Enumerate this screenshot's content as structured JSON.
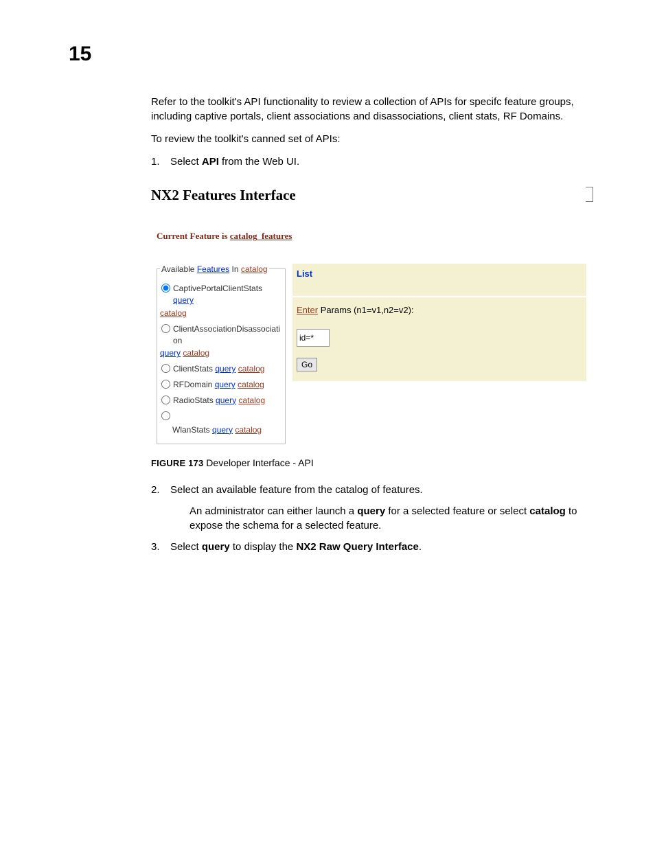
{
  "page": {
    "number": "15"
  },
  "intro": {
    "para1": "Refer to the toolkit's API functionality to review a collection of APIs for specifc feature groups, including captive portals, client associations and disassociations, client stats, RF Domains.",
    "para2": "To review the toolkit's canned set of APIs:"
  },
  "step1": {
    "num": "1.",
    "pre": "Select ",
    "bold": "API",
    "post": " from the Web UI."
  },
  "screenshot": {
    "title": "NX2 Features Interface",
    "current_prefix": "Current Feature is ",
    "current_link": "catalog_features",
    "legend": {
      "pre": "Available ",
      "features": "Features",
      "mid": " In ",
      "catalog": "catalog"
    },
    "features": [
      {
        "name": "CaptivePortalClientStats",
        "q": "query",
        "c": "catalog",
        "checked": true,
        "twoLine": true
      },
      {
        "name": "ClientAssociationDisassociation",
        "q": "query",
        "c": "catalog",
        "checked": false,
        "twoLine": true
      },
      {
        "name": "ClientStats",
        "q": "query",
        "c": "catalog",
        "checked": false,
        "twoLine": false
      },
      {
        "name": "RFDomain",
        "q": "query",
        "c": "catalog",
        "checked": false,
        "twoLine": false
      },
      {
        "name": "RadioStats",
        "q": "query",
        "c": "catalog",
        "checked": false,
        "twoLine": false
      },
      {
        "name": "WlanStats",
        "q": "query",
        "c": "catalog",
        "checked": false,
        "twoLine": false,
        "radioDetached": true
      }
    ],
    "right": {
      "list_label": "List",
      "enter": "Enter",
      "params_rest": " Params (n1=v1,n2=v2):",
      "input_value": "id=*",
      "go": "Go"
    }
  },
  "figcap": {
    "num": "FIGURE 173",
    "rest": "   Developer Interface - API"
  },
  "step2": {
    "num": "2.",
    "line": "Select an available feature from the catalog of features.",
    "detail_pre": "An administrator can either launch a ",
    "detail_b1": "query",
    "detail_mid": " for a selected feature or select ",
    "detail_b2": "catalog",
    "detail_post": " to expose the schema for a selected feature."
  },
  "step3": {
    "num": "3.",
    "pre": "Select ",
    "b1": "query",
    "mid": " to display the ",
    "b2": "NX2 Raw Query Interface",
    "post": "."
  }
}
